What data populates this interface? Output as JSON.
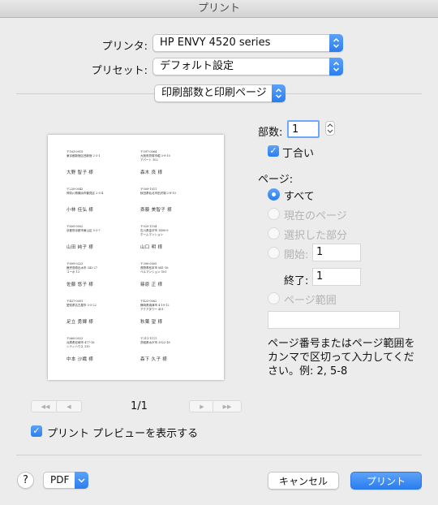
{
  "window": {
    "title": "プリント"
  },
  "printer": {
    "label": "プリンタ:",
    "value": "HP ENVY 4520 series"
  },
  "preset": {
    "label": "プリセット:",
    "value": "デフォルト設定"
  },
  "section": {
    "value": "印刷部数と印刷ページ"
  },
  "copies": {
    "label": "部数:",
    "value": "1"
  },
  "collate": {
    "label": "丁合い",
    "checked": true
  },
  "pages": {
    "label": "ページ:",
    "all": "すべて",
    "current": "現在のページ",
    "selection": "選択した部分",
    "from_label": "開始:",
    "from_value": "1",
    "to_label": "終了:",
    "to_value": "1",
    "range": "ページ範囲",
    "range_value": "",
    "help": "ページ番号またはページ範囲をカンマで区切って入力してください。例: 2, 5-8",
    "selected": "all"
  },
  "preview": {
    "page_indicator": "1/1",
    "show_preview_label": "プリント プレビューを表示する",
    "show_preview_checked": true,
    "labels": [
      {
        "zip": "〒163-0915",
        "line1": "東京都新宿区西新宿 2-3-1",
        "line2": "",
        "name": "大野 智子  様"
      },
      {
        "zip": "〒597-0064",
        "line1": "大阪府貝塚市堀 3-9-10",
        "line2": "アパート 102",
        "name": "森木 良  様"
      },
      {
        "zip": "〒230-0043",
        "line1": "神奈川県横浜市鶴見区 2-5-4",
        "line2": "",
        "name": "小林 佳弘  様"
      },
      {
        "zip": "〒009-1011",
        "line1": "秋田県仙北市田沢湖 2-8-10",
        "line2": "",
        "name": "斎藤 美智子  様"
      },
      {
        "zip": "〒605-0002",
        "line1": "京都府京都市東山区 5-3-7",
        "line2": "",
        "name": "山田 純子  様"
      },
      {
        "zip": "〒920-1104",
        "line1": "石川県金沢市 1480-9",
        "line2": "ホームマンション",
        "name": "山口 明  様"
      },
      {
        "zip": "〒899-0323",
        "line1": "鹿児島県出水市 342-27",
        "line2": "コーポ 13",
        "name": "佐藤 悠子  様"
      },
      {
        "zip": "〒390-0005",
        "line1": "長野県松本市 841-16",
        "line2": "ベルマンション 501",
        "name": "篠原 正  様"
      },
      {
        "zip": "〒457-0001",
        "line1": "愛知県名古屋市 3-5-22",
        "line2": "",
        "name": "足立 勇輝  様"
      },
      {
        "zip": "〒425-0062",
        "line1": "静岡県焼津市 4-19-12",
        "line2": "アクアタワー 451",
        "name": "秋葉 望  様"
      },
      {
        "zip": "〒660-0023",
        "line1": "兵庫県尼崎市 477-16",
        "line2": "シティハウス 310",
        "name": "中本 沙織  様"
      },
      {
        "zip": "〒311-1111",
        "line1": "茨城県水戸市 3922-18",
        "line2": "",
        "name": "森下 久子  様"
      }
    ]
  },
  "footer": {
    "help": "?",
    "pdf": "PDF",
    "cancel": "キャンセル",
    "print": "プリント"
  },
  "colors": {
    "accent": "#2b7ef0",
    "window_bg": "#ececec"
  }
}
